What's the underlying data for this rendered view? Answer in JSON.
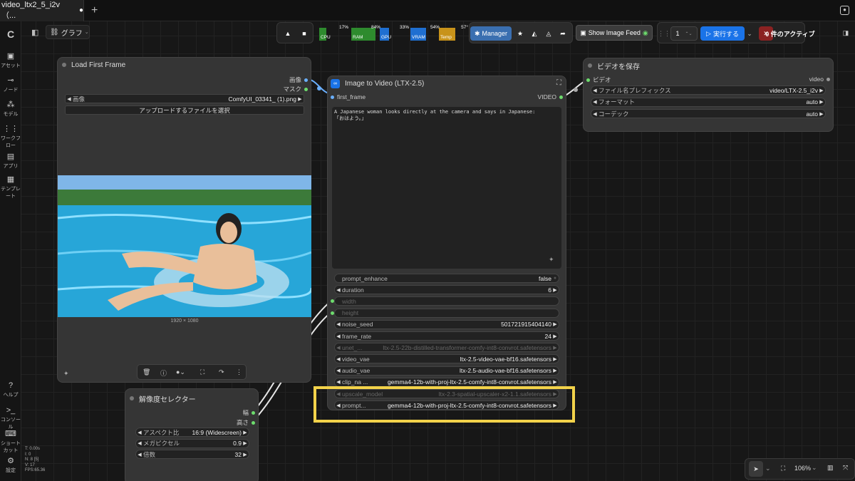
{
  "tabs": [
    {
      "title": "video_ltx2_5_i2v（...",
      "modified_dot": "●"
    }
  ],
  "tab_add": "+",
  "sidebar": {
    "items": [
      {
        "label": "アセット",
        "icon": "images-icon"
      },
      {
        "label": "ノード",
        "icon": "node-icon"
      },
      {
        "label": "モデル",
        "icon": "model-icon"
      },
      {
        "label": "ワークフロー",
        "icon": "workflow-icon"
      },
      {
        "label": "アプリ",
        "icon": "app-icon"
      },
      {
        "label": "テンプレート",
        "icon": "template-icon"
      }
    ],
    "bottom": [
      {
        "label": "ヘルプ",
        "icon": "help-icon"
      },
      {
        "label": "コンソール",
        "icon": "console-icon"
      },
      {
        "label": "ショートカット",
        "icon": "keyboard-icon"
      },
      {
        "label": "設定",
        "icon": "gear-icon"
      }
    ]
  },
  "stats": [
    "T: 0.00s",
    "I: 0",
    "N: 8 [5]",
    "V: 17",
    "FPS:65.36"
  ],
  "graph_button": "グラフ",
  "toolbar": {
    "meters": [
      {
        "label": "CPU",
        "pct": "17%",
        "color": "#2e8b2e",
        "level": 0.17
      },
      {
        "label": "RAM",
        "pct": "84%",
        "color": "#2e8b2e",
        "level": 0.84
      },
      {
        "label": "GPU",
        "pct": "33%",
        "color": "#1f6fd1",
        "level": 0.33
      },
      {
        "label": "VRAM",
        "pct": "54%",
        "color": "#1f6fd1",
        "level": 0.54
      },
      {
        "label": "Temp",
        "pct": "57°",
        "color": "#c8931a",
        "level": 0.57
      }
    ],
    "manager_label": "Manager",
    "image_feed_label": "Show Image Feed",
    "batch_count": "1",
    "run_label": "実行する",
    "queue_label": "0 件のアクティブ"
  },
  "load_node": {
    "title": "Load First Frame",
    "outputs": [
      "画像",
      "マスク"
    ],
    "image_widget": {
      "name": "画像",
      "value": "ComfyUI_03341_ (1).png"
    },
    "upload_label": "アップロードするファイルを選択",
    "resolution": "1920 × 1080"
  },
  "i2v_node": {
    "title": "Image to Video (LTX-2.5)",
    "input": "first_frame",
    "output": "VIDEO",
    "prompt": "A Japanese woman looks directly at the camera and says in Japanese:\n「おはよう。」",
    "widgets": [
      {
        "name": "prompt_enhance",
        "value": "false",
        "type": "toggle"
      },
      {
        "name": "duration",
        "value": "6"
      },
      {
        "name": "width",
        "value": "",
        "disabled": true
      },
      {
        "name": "height",
        "value": "",
        "disabled": true
      },
      {
        "name": "noise_seed",
        "value": "501721915404140"
      },
      {
        "name": "frame_rate",
        "value": "24"
      },
      {
        "name": "unet_...",
        "value": "ltx-2.5-22b-distilled-transformer-comfy-int8-convrot.safetensors",
        "disabled": true
      },
      {
        "name": "video_vae",
        "value": "ltx-2.5-video-vae-bf16.safetensors"
      },
      {
        "name": "audio_vae",
        "value": "ltx-2.5-audio-vae-bf16.safetensors"
      },
      {
        "name": "clip_na ...",
        "value": "gemma4-12b-with-proj-ltx-2.5-comfy-int8-convrot.safetensors"
      },
      {
        "name": "upscale_model",
        "value": "ltx-2.3-spatial-upscaler-x2-1.1.safetensors",
        "disabled": true
      },
      {
        "name": "prompt...",
        "value": "gemma4-12b-with-proj-ltx-2.5-comfy-int8-convrot.safetensors"
      }
    ]
  },
  "save_node": {
    "title": "ビデオを保存",
    "input": "ビデオ",
    "output": "video",
    "widgets": [
      {
        "name": "ファイル名プレフィックス",
        "value": "video/LTX-2.5_i2v"
      },
      {
        "name": "フォーマット",
        "value": "auto"
      },
      {
        "name": "コーデック",
        "value": "auto"
      }
    ]
  },
  "res_node": {
    "title": "解像度セレクター",
    "outputs": [
      "幅",
      "高さ"
    ],
    "widgets": [
      {
        "name": "アスペクト比",
        "value": "16:9 (Widescreen)"
      },
      {
        "name": "メガピクセル",
        "value": "0.9"
      },
      {
        "name": "倍数",
        "value": "32"
      }
    ]
  },
  "canvas": {
    "zoom": "106%"
  },
  "colors": {
    "run_blue": "#1a73e8",
    "manager_blue": "#3a6fb0",
    "highlight": "#f2d24a",
    "link_green": "#6ddc6d"
  }
}
